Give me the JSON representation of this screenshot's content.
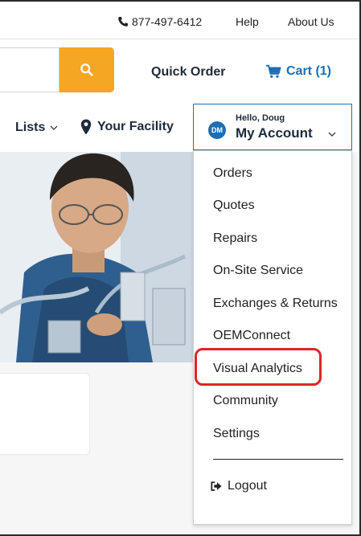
{
  "topbar": {
    "phone": "877-497-6412",
    "help": "Help",
    "about": "About Us"
  },
  "header": {
    "quick_order": "Quick Order",
    "cart": "Cart (1)"
  },
  "nav": {
    "lists": "Lists",
    "facility": "Your Facility"
  },
  "account": {
    "initials": "DM",
    "greeting": "Hello, Doug",
    "label": "My Account"
  },
  "menu": {
    "items": [
      "Orders",
      "Quotes",
      "Repairs",
      "On-Site Service",
      "Exchanges & Returns",
      "OEMConnect",
      "Visual Analytics",
      "Community",
      "Settings"
    ],
    "logout": "Logout"
  },
  "colors": {
    "accent_orange": "#f5a623",
    "brand_blue": "#1c6fb5",
    "highlight_red": "#e02424"
  }
}
